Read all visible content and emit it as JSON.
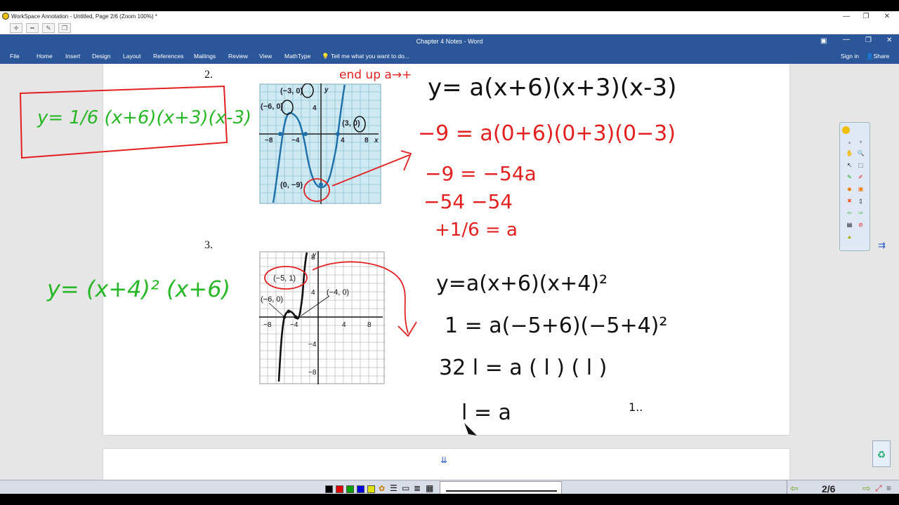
{
  "window": {
    "app_title": "WorkSpace Annotation - Untitled, Page 2/6  (Zoom 100%) *",
    "minimize": "—",
    "maximize": "❐",
    "close": "✕"
  },
  "word": {
    "doc_title": "Chapter 4 Notes - Word",
    "tabs": [
      "File",
      "Home",
      "Insert",
      "Design",
      "Layout",
      "References",
      "Mailings",
      "Review",
      "View",
      "MathType"
    ],
    "tell_me": "Tell me what you want to do...",
    "sign_in": "Sign in",
    "share": "Share"
  },
  "problems": {
    "p2": {
      "number": "2.",
      "boxed_answer": "y= 1/6 (x+6)(x+3)(x-3)",
      "end_behavior_note": "end up a→+",
      "graph_points": [
        "(−3, 0)",
        "(−6, 0)",
        "(3, 0)",
        "(0, −9)"
      ],
      "graph_ticks": {
        "x": [
          "−8",
          "−4",
          "4",
          "8"
        ],
        "y": [
          "4"
        ]
      },
      "graph_axis": {
        "x": "x",
        "y": "y"
      },
      "steps": [
        "y= a(x+6)(x+3)(x-3)",
        "−9 = a(0+6)(0+3)(0−3)",
        "−9 = −54a",
        "−54    −54",
        "+1/6 = a"
      ]
    },
    "p3": {
      "number": "3.",
      "answer": "y= (x+4)² (x+6)",
      "graph_points": [
        "(−5, 1)",
        "(−6, 0)",
        "(−4, 0)"
      ],
      "graph_ticks": {
        "x": [
          "−8",
          "−4",
          "4",
          "8"
        ],
        "y": [
          "8",
          "4",
          "−4",
          "−8"
        ]
      },
      "graph_axis": {
        "y": "y"
      },
      "steps": [
        "y=a(x+6)(x+4)²",
        "1 = a(−5+6)(−5+4)²",
        "32  l = a ( l )   ( l )",
        "l = a"
      ],
      "stray_mark": "1.."
    }
  },
  "bottom": {
    "page_indicator": "2/6",
    "prev": "⇦",
    "next": "⇨",
    "colors": [
      "#000000",
      "#e00000",
      "#00a000",
      "#0000e0",
      "#e0e000"
    ]
  }
}
